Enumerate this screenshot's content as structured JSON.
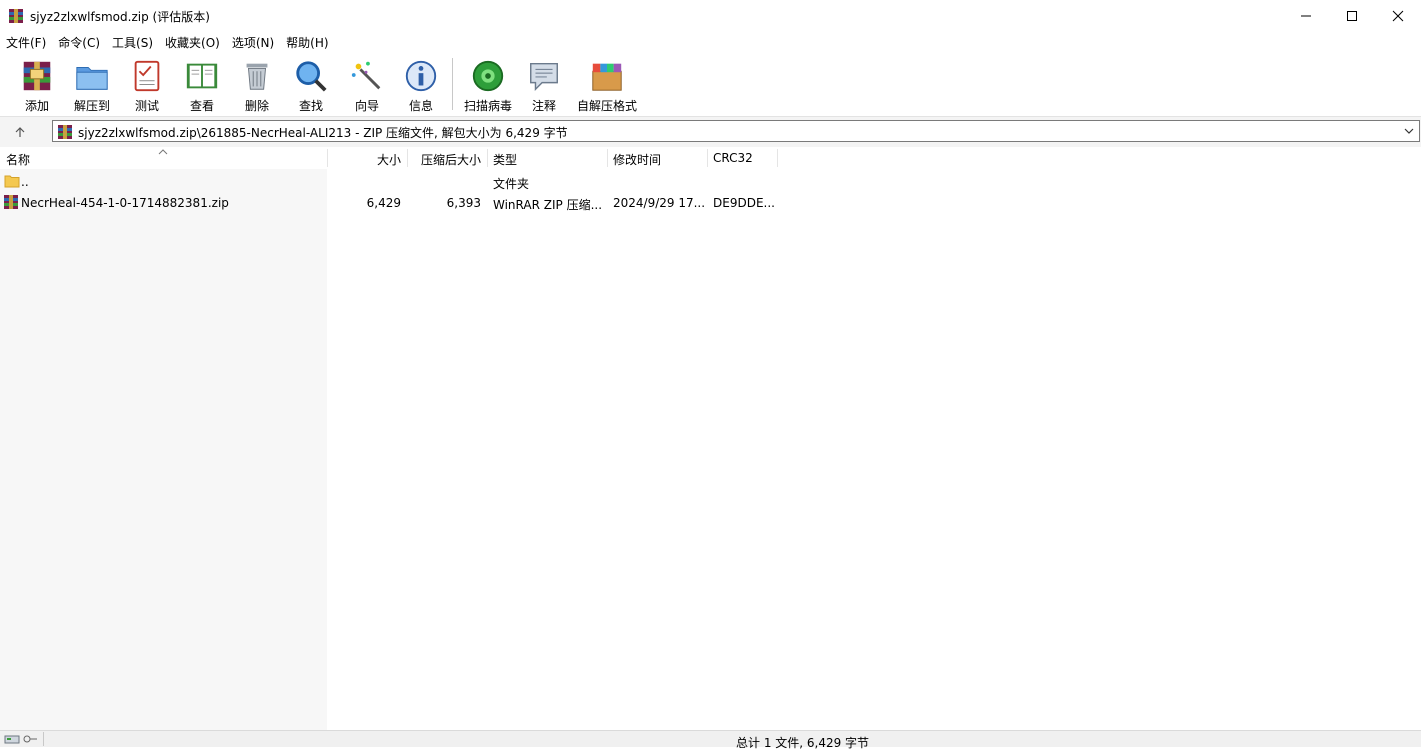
{
  "window": {
    "title": "sjyz2zlxwlfsmod.zip (评估版本)"
  },
  "menu": [
    "文件(F)",
    "命令(C)",
    "工具(S)",
    "收藏夹(O)",
    "选项(N)",
    "帮助(H)"
  ],
  "toolbar": {
    "add": "添加",
    "extract_to": "解压到",
    "test": "测试",
    "view": "查看",
    "delete": "删除",
    "find": "查找",
    "wizard": "向导",
    "info": "信息",
    "scan": "扫描病毒",
    "comment": "注释",
    "sfx": "自解压格式"
  },
  "address": {
    "path": "sjyz2zlxwlfsmod.zip\\261885-NecrHeal-ALI213 - ZIP 压缩文件, 解包大小为 6,429 字节"
  },
  "columns": {
    "name": "名称",
    "size": "大小",
    "packed": "压缩后大小",
    "type": "类型",
    "modified": "修改时间",
    "crc": "CRC32"
  },
  "rows": [
    {
      "name": "..",
      "size": "",
      "packed": "",
      "type": "文件夹",
      "modified": "",
      "crc": ""
    },
    {
      "name": "NecrHeal-454-1-0-1714882381.zip",
      "size": "6,429",
      "packed": "6,393",
      "type": "WinRAR ZIP 压缩...",
      "modified": "2024/9/29 17...",
      "crc": "DE9DDE..."
    }
  ],
  "status": {
    "summary": "总计 1 文件, 6,429 字节"
  },
  "icons": {
    "app": "winrar-icon",
    "up": "arrow-up-icon",
    "dropdown": "chevron-down-icon",
    "folder": "folder-icon",
    "archive": "archive-icon"
  },
  "colors": {
    "folder": "#f4c84f",
    "title_bg": "#ffffff",
    "addr_bg": "#f4f4f4",
    "status_bg": "#f0f0f0"
  }
}
